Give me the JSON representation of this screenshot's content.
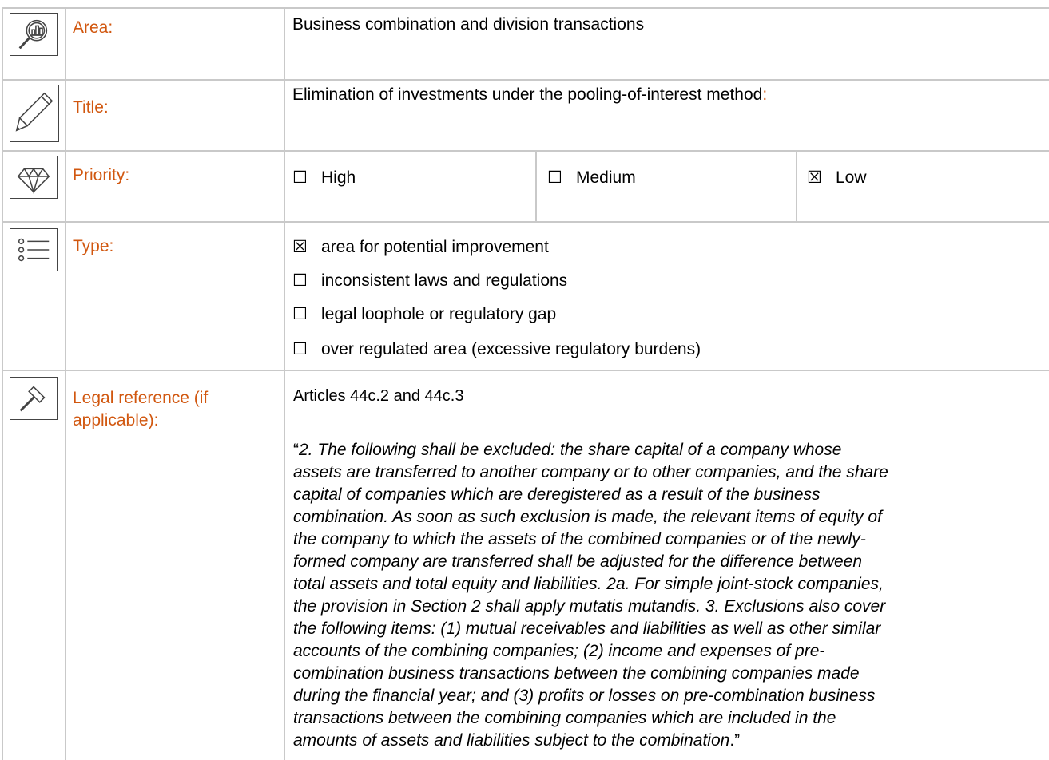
{
  "rows": {
    "area": {
      "icon": "magnifier-chart-icon",
      "label": "Area:",
      "value": "Business combination and division transactions"
    },
    "title": {
      "icon": "pencil-icon",
      "label": "Title:",
      "value": "Elimination of investments under the pooling-of-interest method",
      "value_suffix": ":"
    },
    "priority": {
      "icon": "diamond-icon",
      "label": "Priority:",
      "options": [
        {
          "box": "☐",
          "label": "High",
          "checked": false
        },
        {
          "box": "☐",
          "label": "Medium",
          "checked": false
        },
        {
          "box": "☒",
          "label": "Low",
          "checked": true
        }
      ]
    },
    "type": {
      "icon": "list-icon",
      "label": "Type:",
      "options": [
        {
          "box": "☒",
          "label": "area for potential improvement",
          "checked": true
        },
        {
          "box": "☐",
          "label": "inconsistent laws and regulations",
          "checked": false
        },
        {
          "box": "☐",
          "label": "legal loophole or regulatory gap",
          "checked": false
        },
        {
          "box": "☐",
          "label": "over regulated area (excessive regulatory burdens)",
          "checked": false
        }
      ]
    },
    "legal": {
      "icon": "gavel-icon",
      "label_lines": [
        "Legal reference (if",
        "applicable):"
      ],
      "articles": "Articles 44c.2 and 44c.3",
      "quote_open": "“",
      "quote_lines": [
        "2. The following shall be excluded: the share capital of a company whose",
        "assets are transferred to another company or to other companies, and the share",
        "capital of companies which are deregistered as a result of the business",
        "combination. As soon as such exclusion is made, the relevant items of equity of",
        "the company to which the assets of the combined companies or of the newly-",
        "formed company are transferred shall be adjusted for the difference between",
        "total assets and total equity and liabilities. 2a. For simple joint-stock companies,",
        "the provision in Section 2 shall apply mutatis mutandis. 3. Exclusions also cover",
        "the following items: (1) mutual receivables and liabilities as well as other similar",
        "accounts of the combining companies; (2) income and expenses of pre-",
        "combination business transactions between the combining companies made",
        "during the financial year; and (3) profits or losses on pre-combination business",
        "transactions between the combining companies which are included in the",
        "amounts of assets and liabilities subject to the combination"
      ],
      "quote_close": ".”"
    }
  }
}
